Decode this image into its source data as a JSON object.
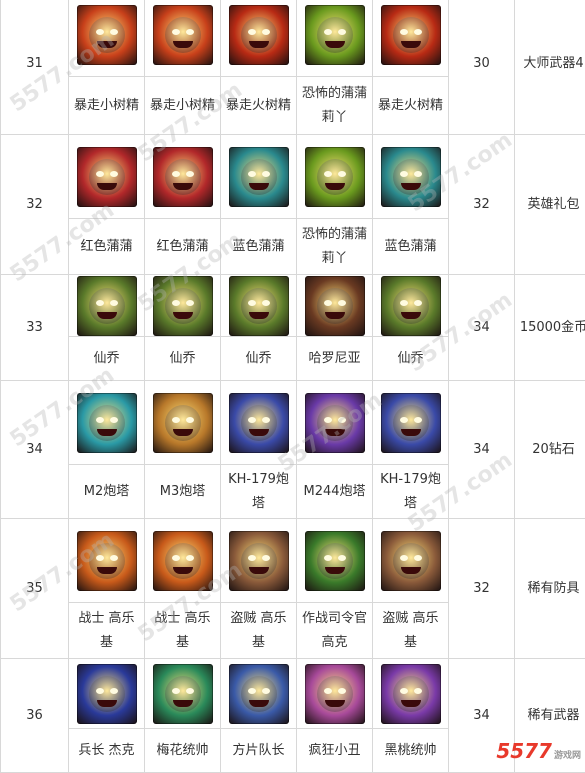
{
  "rows": [
    {
      "level": "31",
      "count": "30",
      "reward": "大师武器4",
      "items": [
        {
          "name": "暴走小树精",
          "icon": "angry-tree-icon",
          "color": "#c8401a"
        },
        {
          "name": "暴走小树精",
          "icon": "angry-tree-icon",
          "color": "#c8401a"
        },
        {
          "name": "暴走火树精",
          "icon": "fire-tree-icon",
          "color": "#b82a14"
        },
        {
          "name": "恐怖的蒲蒲莉丫",
          "icon": "green-monster-icon",
          "color": "#6a9a1e"
        },
        {
          "name": "暴走火树精",
          "icon": "fire-tree-icon",
          "color": "#b82a14"
        }
      ]
    },
    {
      "level": "32",
      "count": "32",
      "reward": "英雄礼包",
      "items": [
        {
          "name": "红色蒲蒲",
          "icon": "red-puffer-icon",
          "color": "#b2282a"
        },
        {
          "name": "红色蒲蒲",
          "icon": "red-puffer-icon",
          "color": "#b2282a"
        },
        {
          "name": "蓝色蒲蒲",
          "icon": "blue-puffer-icon",
          "color": "#2a8a8e"
        },
        {
          "name": "恐怖的蒲蒲莉丫",
          "icon": "green-monster-icon",
          "color": "#6a9a1e"
        },
        {
          "name": "蓝色蒲蒲",
          "icon": "blue-puffer-icon",
          "color": "#2a8a8e"
        }
      ]
    },
    {
      "level": "33",
      "count": "34",
      "reward": "15000金币",
      "items": [
        {
          "name": "仙乔",
          "icon": "cactus-cowboy-icon",
          "color": "#5a7a2a"
        },
        {
          "name": "仙乔",
          "icon": "cactus-cowboy-icon",
          "color": "#5a7a2a"
        },
        {
          "name": "仙乔",
          "icon": "cactus-cowboy-icon",
          "color": "#5a7a2a"
        },
        {
          "name": "哈罗尼亚",
          "icon": "cowboy-icon",
          "color": "#6a3a22"
        },
        {
          "name": "仙乔",
          "icon": "cactus-cowboy-icon",
          "color": "#5a7a2a"
        }
      ]
    },
    {
      "level": "34",
      "count": "34",
      "reward": "20钻石",
      "items": [
        {
          "name": "M2炮塔",
          "icon": "turret-icon",
          "color": "#2a9aa6"
        },
        {
          "name": "M3炮塔",
          "icon": "turret-icon",
          "color": "#b8782a"
        },
        {
          "name": "KH-179炮塔",
          "icon": "turret-icon",
          "color": "#3a4aa8"
        },
        {
          "name": "M244炮塔",
          "icon": "turret-icon",
          "color": "#6a3aa8"
        },
        {
          "name": "KH-179炮塔",
          "icon": "turret-icon",
          "color": "#3a4aa8"
        }
      ]
    },
    {
      "level": "35",
      "count": "32",
      "reward": "稀有防具",
      "items": [
        {
          "name": "战士 高乐基",
          "icon": "warrior-icon",
          "color": "#c85a1a"
        },
        {
          "name": "战士 高乐基",
          "icon": "warrior-icon",
          "color": "#c85a1a"
        },
        {
          "name": "盗贼 高乐基",
          "icon": "rogue-icon",
          "color": "#8a5a3a"
        },
        {
          "name": "作战司令官 高克",
          "icon": "commander-icon",
          "color": "#3a7a2a"
        },
        {
          "name": "盗贼 高乐基",
          "icon": "rogue-icon",
          "color": "#8a5a3a"
        }
      ]
    },
    {
      "level": "36",
      "count": "34",
      "reward": "稀有武器",
      "items": [
        {
          "name": "兵长 杰克",
          "icon": "red-card-soldier-icon",
          "color": "#2a3a9a"
        },
        {
          "name": "梅花统帅",
          "icon": "club-marshal-icon",
          "color": "#2a8a5a"
        },
        {
          "name": "方片队长",
          "icon": "diamond-captain-icon",
          "color": "#3a5aa8"
        },
        {
          "name": "疯狂小丑",
          "icon": "crazy-clown-icon",
          "color": "#a84a9a"
        },
        {
          "name": "黑桃统帅",
          "icon": "spade-marshal-icon",
          "color": "#7a3aa8"
        }
      ]
    }
  ],
  "watermark": "5577.com",
  "logo": {
    "text": "5577",
    "sub": "游戏网"
  }
}
